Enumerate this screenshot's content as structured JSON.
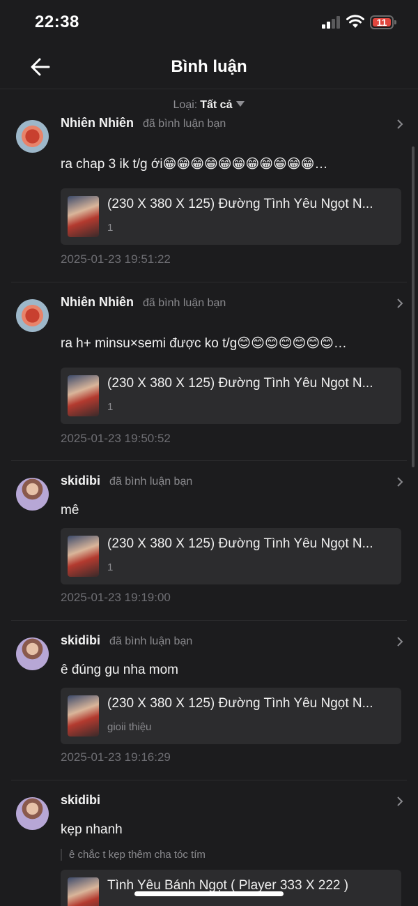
{
  "status_bar": {
    "time": "22:38",
    "battery": "11"
  },
  "nav": {
    "title": "Bình luận"
  },
  "filter": {
    "label": "Loại:",
    "value": "Tất cả"
  },
  "items": [
    {
      "username": "Nhiên Nhiên",
      "action": "đã bình luận bạn",
      "comment": "ra chap 3 ik t/g ới😁😁😁😁😁😁😁😁😁😁😁…",
      "card_title": "(230 X 380 X 125) Đường Tình Yêu Ngọt N...",
      "card_sub": "1",
      "timestamp": "2025-01-23 19:51:22"
    },
    {
      "username": "Nhiên Nhiên",
      "action": "đã bình luận bạn",
      "comment": "ra h+ minsu×semi được ko t/g😊😊😊😊😊😊😊…",
      "card_title": "(230 X 380 X 125) Đường Tình Yêu Ngọt N...",
      "card_sub": "1",
      "timestamp": "2025-01-23 19:50:52"
    },
    {
      "username": "skidibi",
      "action": "đã bình luận bạn",
      "comment": "mê",
      "card_title": "(230 X 380 X 125) Đường Tình Yêu Ngọt N...",
      "card_sub": "1",
      "timestamp": "2025-01-23 19:19:00"
    },
    {
      "username": "skidibi",
      "action": "đã bình luận bạn",
      "comment": "ê đúng gu nha mom",
      "card_title": "(230 X 380 X 125) Đường Tình Yêu Ngọt N...",
      "card_sub": "gioii thiệu",
      "timestamp": "2025-01-23 19:16:29"
    },
    {
      "username": "skidibi",
      "action": "",
      "comment": "kẹp nhanh",
      "quote": "ê chắc t kẹp thêm cha tóc tím",
      "card_title": "Tình Yêu Bánh Ngọt ( Player 333 X 222 )",
      "card_sub": ""
    }
  ]
}
